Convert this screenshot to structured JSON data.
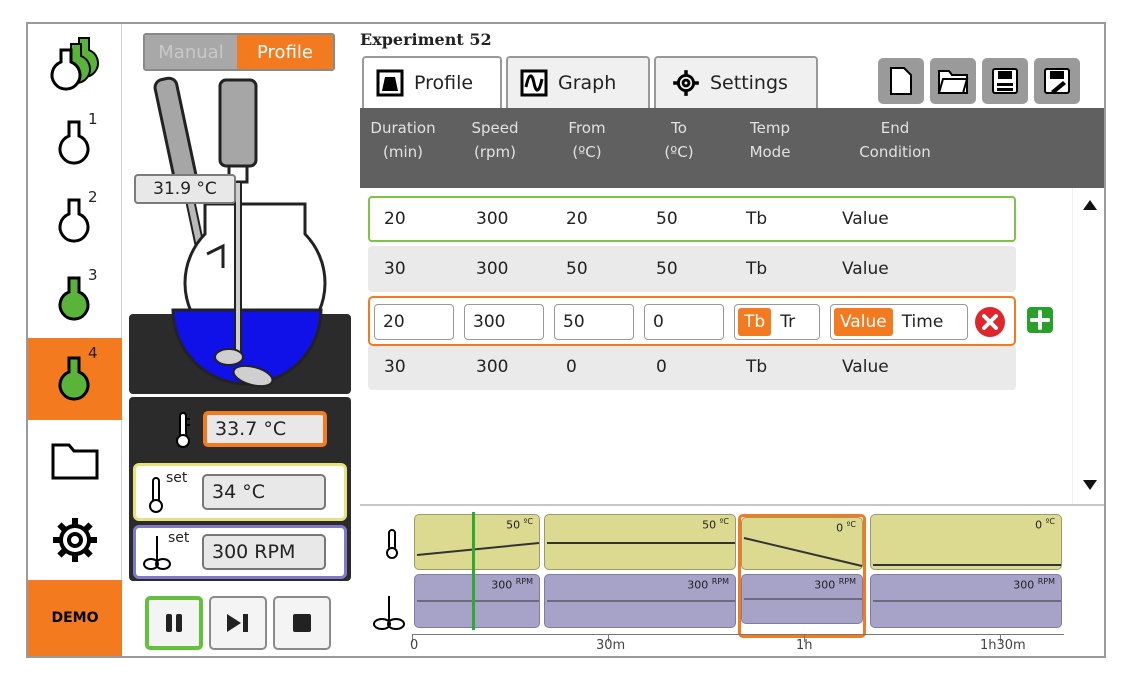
{
  "rail": {
    "vessels": [
      {
        "id": "all",
        "label": ""
      },
      {
        "id": "1",
        "label": "1"
      },
      {
        "id": "2",
        "label": "2"
      },
      {
        "id": "3",
        "label": "3"
      },
      {
        "id": "4",
        "label": "4"
      }
    ],
    "demo_label": "DEMO"
  },
  "vessel": {
    "mode_manual": "Manual",
    "mode_profile": "Profile",
    "probe_temp": "31.9 °C",
    "temp": "33.7 °C",
    "temp_set": "34 °C",
    "speed_set": "300 RPM",
    "set_label": "set"
  },
  "main": {
    "experiment_title": "Experiment 52",
    "tabs": [
      {
        "label": "Profile",
        "icon": "profile-icon"
      },
      {
        "label": "Graph",
        "icon": "graph-icon"
      },
      {
        "label": "Settings",
        "icon": "gear-icon"
      }
    ]
  },
  "table": {
    "headers": [
      {
        "l1": "Duration",
        "l2": "(min)"
      },
      {
        "l1": "Speed",
        "l2": "(rpm)"
      },
      {
        "l1": "From",
        "l2": "(ºC)"
      },
      {
        "l1": "To",
        "l2": "(ºC)"
      },
      {
        "l1": "Temp",
        "l2": "Mode"
      },
      {
        "l1": "End",
        "l2": "Condition"
      }
    ],
    "rows": [
      {
        "duration": "20",
        "speed": "300",
        "from": "20",
        "to": "50",
        "mode": "Tb",
        "end": "Value"
      },
      {
        "duration": "30",
        "speed": "300",
        "from": "50",
        "to": "50",
        "mode": "Tb",
        "end": "Value"
      },
      {
        "duration": "30",
        "speed": "300",
        "from": "0",
        "to": "0",
        "mode": "Tb",
        "end": "Value"
      }
    ],
    "edit_row": {
      "duration": "20",
      "speed": "300",
      "from": "50",
      "to": "0",
      "mode_a": "Tb",
      "mode_b": "Tr",
      "end_a": "Value",
      "end_b": "Time"
    }
  },
  "timeline": {
    "temp_segments": [
      {
        "label": "50",
        "unit": "ºC"
      },
      {
        "label": "50",
        "unit": "ºC"
      },
      {
        "label": "0",
        "unit": "ºC"
      },
      {
        "label": "0",
        "unit": "ºC"
      }
    ],
    "speed_segments": [
      {
        "label": "300",
        "unit": "RPM"
      },
      {
        "label": "300",
        "unit": "RPM"
      },
      {
        "label": "300",
        "unit": "RPM"
      },
      {
        "label": "300",
        "unit": "RPM"
      }
    ],
    "ticks": [
      "0",
      "30m",
      "1h",
      "1h30m"
    ]
  },
  "colors": {
    "accent": "#f47a1f",
    "green": "#62c23a",
    "temp_track": "#dcd991",
    "speed_track": "#a6a2c8"
  }
}
